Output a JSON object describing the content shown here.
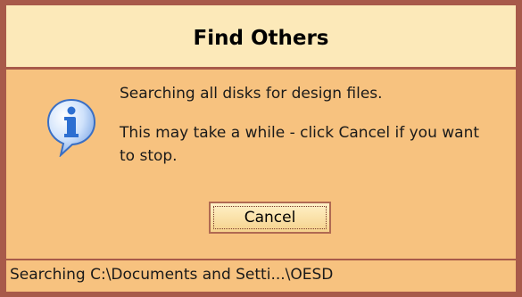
{
  "dialog": {
    "title": "Find Others",
    "message_line_1": "Searching all disks for design files.",
    "message_line_2": "This may take a while - click Cancel if you want to stop.",
    "cancel_label": "Cancel",
    "status_text": "Searching C:\\Documents and Setti...\\OESD",
    "icon": "info-icon"
  },
  "colors": {
    "frame": "#a85a4a",
    "titlebar_bg": "#fce9b9",
    "body_bg": "#f7c27f",
    "icon_blue": "#2d6fd1"
  }
}
